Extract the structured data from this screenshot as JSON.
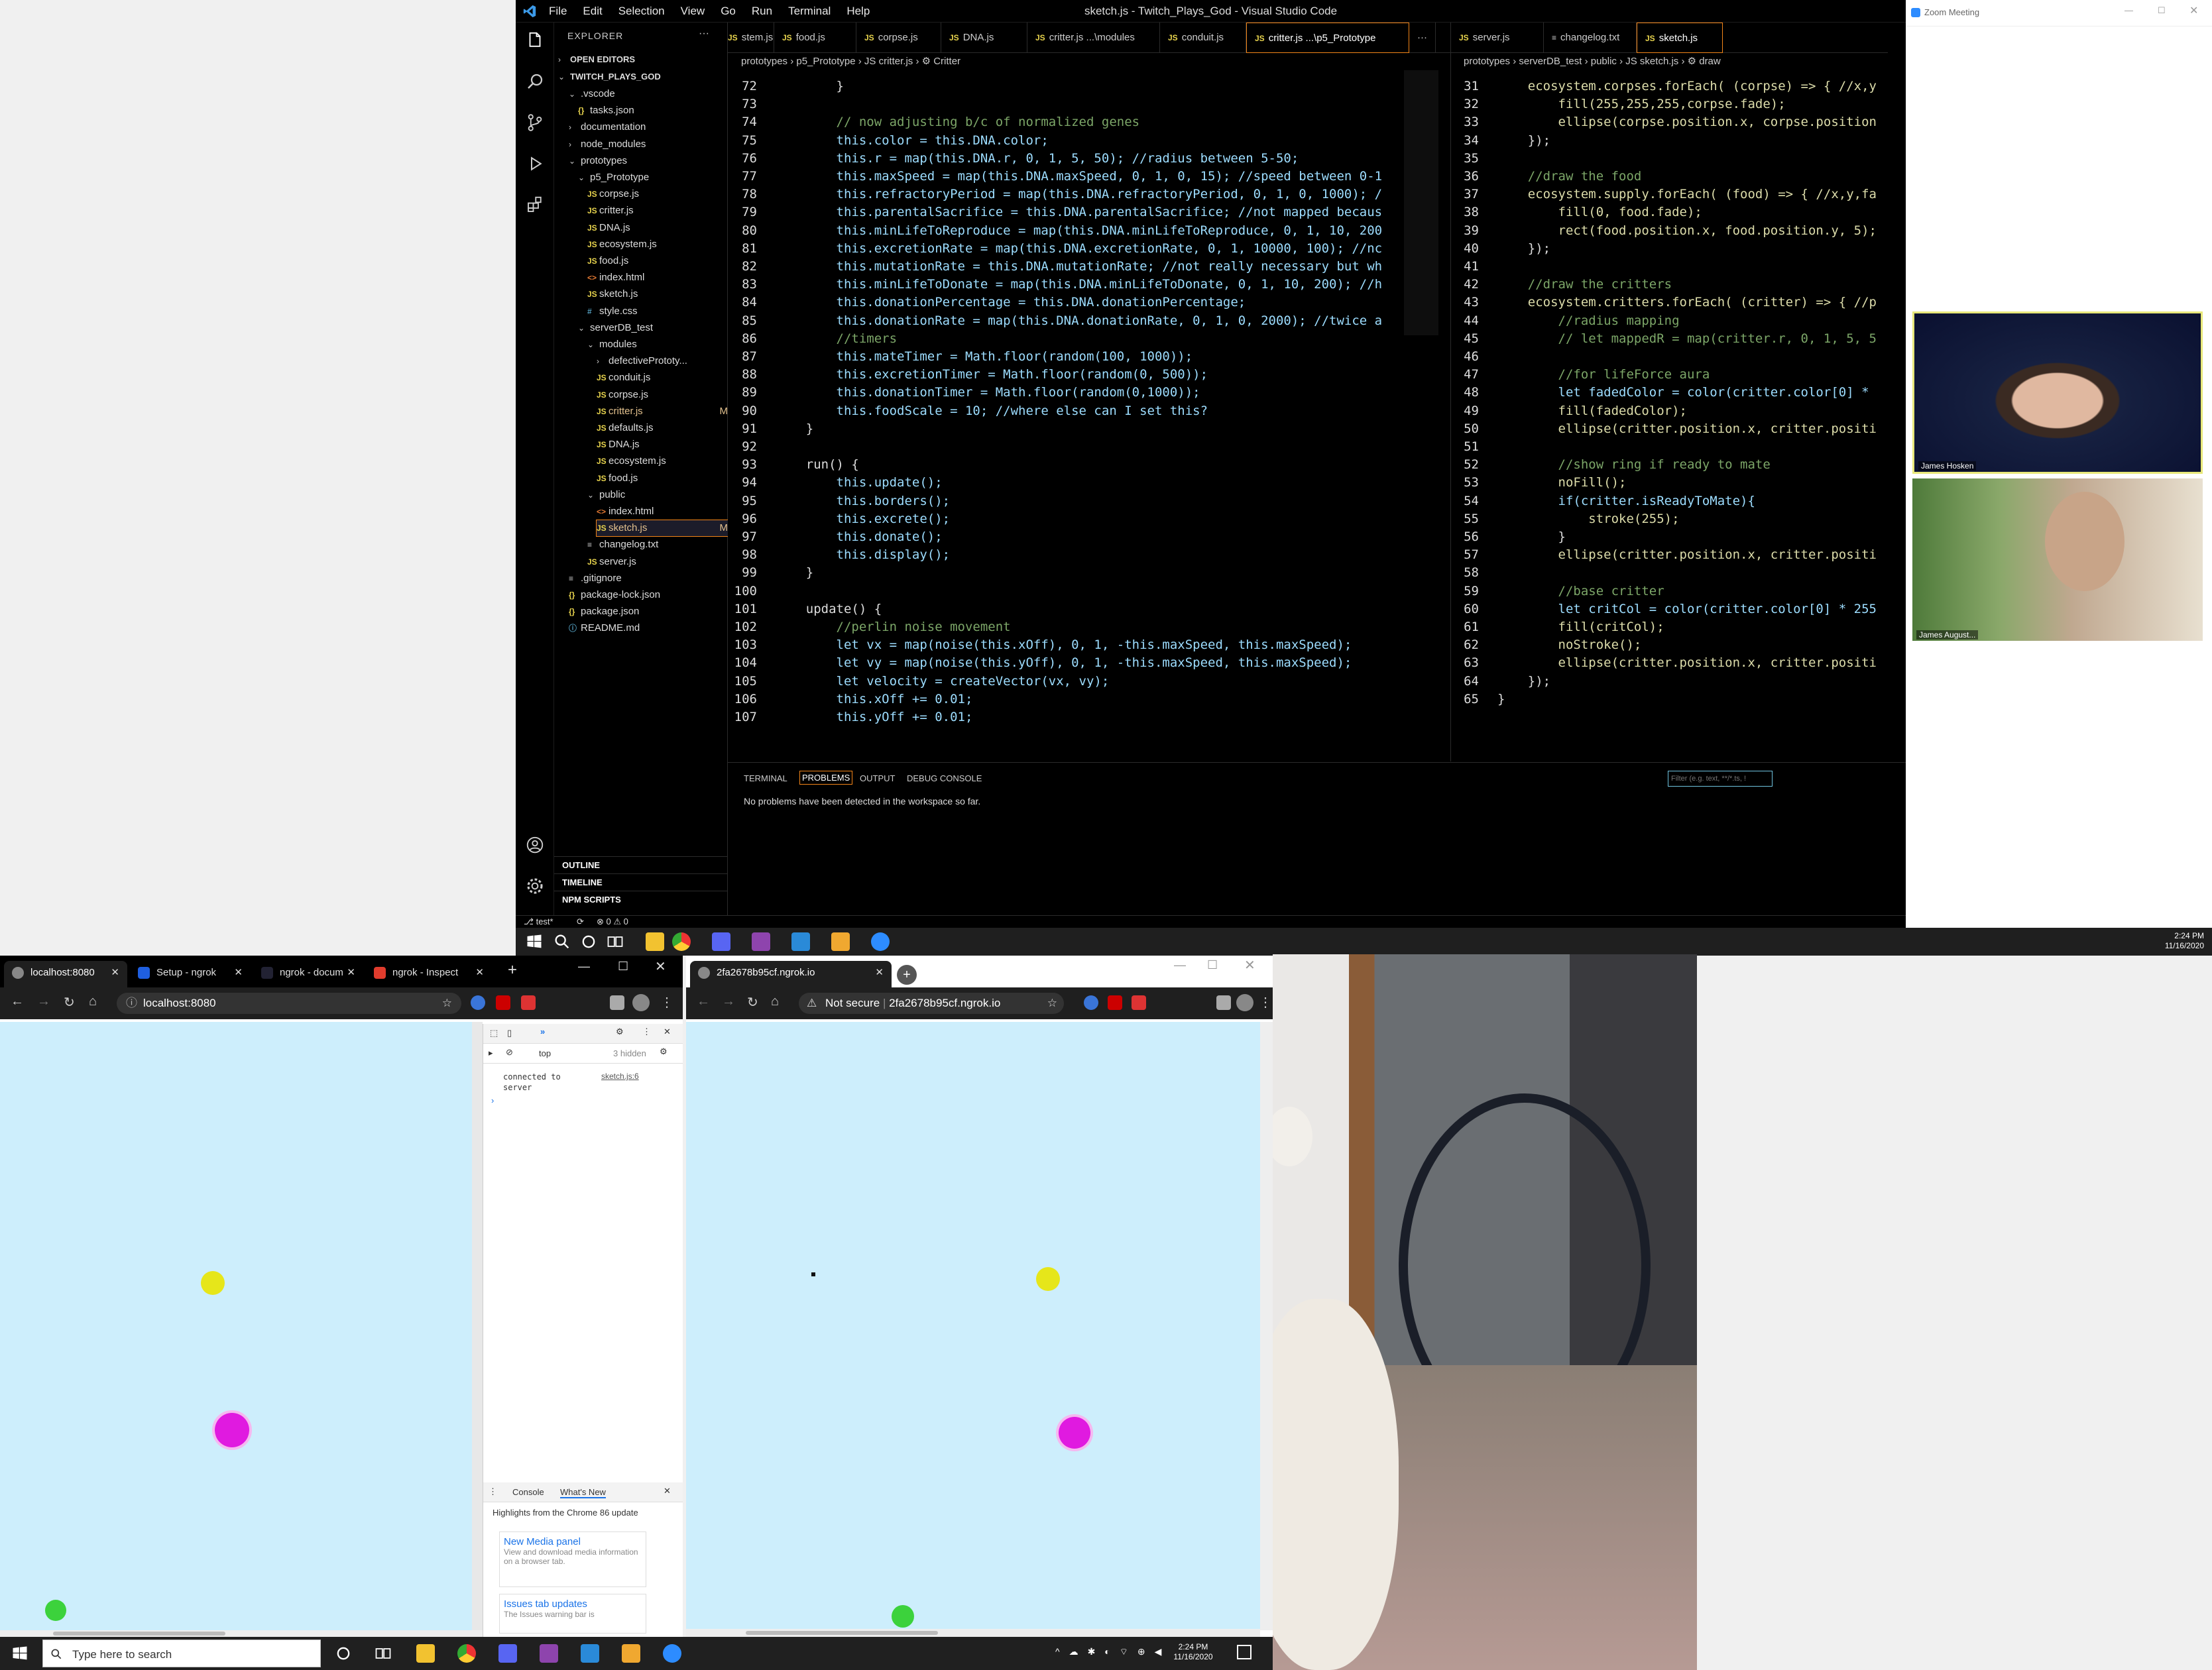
{
  "vscode": {
    "window_title": "sketch.js - Twitch_Plays_God - Visual Studio Code",
    "menu": [
      "File",
      "Edit",
      "Selection",
      "View",
      "Go",
      "Run",
      "Terminal",
      "Help"
    ],
    "explorer": {
      "header": "EXPLORER",
      "open_editors": "OPEN EDITORS",
      "root": "TWITCH_PLAYS_GOD",
      "tree": [
        {
          "label": ".vscode",
          "type": "folder-open",
          "depth": 1
        },
        {
          "label": "tasks.json",
          "type": "json",
          "depth": 2
        },
        {
          "label": "documentation",
          "type": "folder",
          "depth": 1
        },
        {
          "label": "node_modules",
          "type": "folder",
          "depth": 1
        },
        {
          "label": "prototypes",
          "type": "folder-open",
          "depth": 1
        },
        {
          "label": "p5_Prototype",
          "type": "folder-open",
          "depth": 2
        },
        {
          "label": "corpse.js",
          "type": "js",
          "depth": 3
        },
        {
          "label": "critter.js",
          "type": "js",
          "depth": 3
        },
        {
          "label": "DNA.js",
          "type": "js",
          "depth": 3
        },
        {
          "label": "ecosystem.js",
          "type": "js",
          "depth": 3
        },
        {
          "label": "food.js",
          "type": "js",
          "depth": 3
        },
        {
          "label": "index.html",
          "type": "html",
          "depth": 3
        },
        {
          "label": "sketch.js",
          "type": "js",
          "depth": 3
        },
        {
          "label": "style.css",
          "type": "css",
          "depth": 3
        },
        {
          "label": "serverDB_test",
          "type": "folder-open",
          "depth": 2
        },
        {
          "label": "modules",
          "type": "folder-open",
          "depth": 3
        },
        {
          "label": "defectivePrototy...",
          "type": "folder",
          "depth": 4
        },
        {
          "label": "conduit.js",
          "type": "js",
          "depth": 4
        },
        {
          "label": "corpse.js",
          "type": "js",
          "depth": 4
        },
        {
          "label": "critter.js",
          "type": "js",
          "depth": 4,
          "badge": "M"
        },
        {
          "label": "defaults.js",
          "type": "js",
          "depth": 4
        },
        {
          "label": "DNA.js",
          "type": "js",
          "depth": 4
        },
        {
          "label": "ecosystem.js",
          "type": "js",
          "depth": 4
        },
        {
          "label": "food.js",
          "type": "js",
          "depth": 4
        },
        {
          "label": "public",
          "type": "folder-open",
          "depth": 3
        },
        {
          "label": "index.html",
          "type": "html",
          "depth": 4
        },
        {
          "label": "sketch.js",
          "type": "js",
          "depth": 4,
          "badge": "M",
          "selected": true
        },
        {
          "label": "changelog.txt",
          "type": "txt",
          "depth": 3
        },
        {
          "label": "server.js",
          "type": "js",
          "depth": 3
        },
        {
          "label": ".gitignore",
          "type": "txt",
          "depth": 1
        },
        {
          "label": "package-lock.json",
          "type": "json",
          "depth": 1
        },
        {
          "label": "package.json",
          "type": "json",
          "depth": 1
        },
        {
          "label": "README.md",
          "type": "info",
          "depth": 1
        }
      ],
      "sections": [
        "OUTLINE",
        "TIMELINE",
        "NPM SCRIPTS"
      ]
    },
    "tabs_left": [
      "stem.js",
      "food.js",
      "corpse.js",
      "DNA.js",
      "critter.js ...\\modules",
      "conduit.js",
      "critter.js ...\\p5_Prototype"
    ],
    "tabs_right": [
      "server.js",
      "changelog.txt",
      "sketch.js"
    ],
    "tab_more": "···",
    "breadcrumb_left": "prototypes › p5_Prototype › JS critter.js › ⚙ Critter",
    "breadcrumb_right": "prototypes › serverDB_test › public › JS sketch.js › ⚙ draw",
    "left_code": [
      {
        "ln": "72",
        "code": "        }"
      },
      {
        "ln": "73",
        "code": ""
      },
      {
        "ln": "74",
        "code": "        // now adjusting b/c of normalized genes"
      },
      {
        "ln": "75",
        "code": "        this.color = this.DNA.color;"
      },
      {
        "ln": "76",
        "code": "        this.r = map(this.DNA.r, 0, 1, 5, 50); //radius between 5-50;"
      },
      {
        "ln": "77",
        "code": "        this.maxSpeed = map(this.DNA.maxSpeed, 0, 1, 0, 15); //speed between 0-1"
      },
      {
        "ln": "78",
        "code": "        this.refractoryPeriod = map(this.DNA.refractoryPeriod, 0, 1, 0, 1000); /"
      },
      {
        "ln": "79",
        "code": "        this.parentalSacrifice = this.DNA.parentalSacrifice; //not mapped becaus"
      },
      {
        "ln": "80",
        "code": "        this.minLifeToReproduce = map(this.DNA.minLifeToReproduce, 0, 1, 10, 200"
      },
      {
        "ln": "81",
        "code": "        this.excretionRate = map(this.DNA.excretionRate, 0, 1, 10000, 100); //nc"
      },
      {
        "ln": "82",
        "code": "        this.mutationRate = this.DNA.mutationRate; //not really necessary but wh"
      },
      {
        "ln": "83",
        "code": "        this.minLifeToDonate = map(this.DNA.minLifeToDonate, 0, 1, 10, 200); //h"
      },
      {
        "ln": "84",
        "code": "        this.donationPercentage = this.DNA.donationPercentage;"
      },
      {
        "ln": "85",
        "code": "        this.donationRate = map(this.DNA.donationRate, 0, 1, 0, 2000); //twice a"
      },
      {
        "ln": "86",
        "code": "        //timers"
      },
      {
        "ln": "87",
        "code": "        this.mateTimer = Math.floor(random(100, 1000));"
      },
      {
        "ln": "88",
        "code": "        this.excretionTimer = Math.floor(random(0, 500));"
      },
      {
        "ln": "89",
        "code": "        this.donationTimer = Math.floor(random(0,1000));"
      },
      {
        "ln": "90",
        "code": "        this.foodScale = 10; //where else can I set this?"
      },
      {
        "ln": "91",
        "code": "    }"
      },
      {
        "ln": "92",
        "code": ""
      },
      {
        "ln": "93",
        "code": "    run() {"
      },
      {
        "ln": "94",
        "code": "        this.update();"
      },
      {
        "ln": "95",
        "code": "        this.borders();"
      },
      {
        "ln": "96",
        "code": "        this.excrete();"
      },
      {
        "ln": "97",
        "code": "        this.donate();"
      },
      {
        "ln": "98",
        "code": "        this.display();"
      },
      {
        "ln": "99",
        "code": "    }"
      },
      {
        "ln": "100",
        "code": ""
      },
      {
        "ln": "101",
        "code": "    update() {"
      },
      {
        "ln": "102",
        "code": "        //perlin noise movement"
      },
      {
        "ln": "103",
        "code": "        let vx = map(noise(this.xOff), 0, 1, -this.maxSpeed, this.maxSpeed);"
      },
      {
        "ln": "104",
        "code": "        let vy = map(noise(this.yOff), 0, 1, -this.maxSpeed, this.maxSpeed);"
      },
      {
        "ln": "105",
        "code": "        let velocity = createVector(vx, vy);"
      },
      {
        "ln": "106",
        "code": "        this.xOff += 0.01;"
      },
      {
        "ln": "107",
        "code": "        this.yOff += 0.01;"
      }
    ],
    "right_code": [
      {
        "ln": "31",
        "code": "    ecosystem.corpses.forEach( (corpse) => { //x,y"
      },
      {
        "ln": "32",
        "code": "        fill(255,255,255,corpse.fade);"
      },
      {
        "ln": "33",
        "code": "        ellipse(corpse.position.x, corpse.position"
      },
      {
        "ln": "34",
        "code": "    });"
      },
      {
        "ln": "35",
        "code": ""
      },
      {
        "ln": "36",
        "code": "    //draw the food"
      },
      {
        "ln": "37",
        "code": "    ecosystem.supply.forEach( (food) => { //x,y,fa"
      },
      {
        "ln": "38",
        "code": "        fill(0, food.fade);"
      },
      {
        "ln": "39",
        "code": "        rect(food.position.x, food.position.y, 5);"
      },
      {
        "ln": "40",
        "code": "    });"
      },
      {
        "ln": "41",
        "code": ""
      },
      {
        "ln": "42",
        "code": "    //draw the critters"
      },
      {
        "ln": "43",
        "code": "    ecosystem.critters.forEach( (critter) => { //p"
      },
      {
        "ln": "44",
        "code": "        //radius mapping"
      },
      {
        "ln": "45",
        "code": "        // let mappedR = map(critter.r, 0, 1, 5, 5"
      },
      {
        "ln": "46",
        "code": ""
      },
      {
        "ln": "47",
        "code": "        //for lifeForce aura"
      },
      {
        "ln": "48",
        "code": "        let fadedColor = color(critter.color[0] *"
      },
      {
        "ln": "49",
        "code": "        fill(fadedColor);"
      },
      {
        "ln": "50",
        "code": "        ellipse(critter.position.x, critter.positi"
      },
      {
        "ln": "51",
        "code": ""
      },
      {
        "ln": "52",
        "code": "        //show ring if ready to mate"
      },
      {
        "ln": "53",
        "code": "        noFill();"
      },
      {
        "ln": "54",
        "code": "        if(critter.isReadyToMate){"
      },
      {
        "ln": "55",
        "code": "            stroke(255);"
      },
      {
        "ln": "56",
        "code": "        }"
      },
      {
        "ln": "57",
        "code": "        ellipse(critter.position.x, critter.positi"
      },
      {
        "ln": "58",
        "code": ""
      },
      {
        "ln": "59",
        "code": "        //base critter"
      },
      {
        "ln": "60",
        "code": "        let critCol = color(critter.color[0] * 255"
      },
      {
        "ln": "61",
        "code": "        fill(critCol);"
      },
      {
        "ln": "62",
        "code": "        noStroke();"
      },
      {
        "ln": "63",
        "code": "        ellipse(critter.position.x, critter.positi"
      },
      {
        "ln": "64",
        "code": "    });"
      },
      {
        "ln": "65",
        "code": "}"
      }
    ],
    "panel": {
      "tabs": [
        "TERMINAL",
        "PROBLEMS",
        "OUTPUT",
        "DEBUG CONSOLE"
      ],
      "active_tab": "PROBLEMS",
      "message": "No problems have been detected in the workspace so far.",
      "filter_placeholder": "Filter (e.g. text, **/*.ts, !"
    },
    "status": {
      "branch": "test*",
      "problems": "⊗ 0 ⚠ 0"
    }
  },
  "zoom": {
    "title": "Zoom Meeting",
    "participant1": "James Hosken",
    "participant2": "James August..."
  },
  "taskbar_top": {
    "time": "2:24 PM",
    "date": "11/16/2020"
  },
  "taskbar_bottom": {
    "search_placeholder": "Type here to search",
    "time": "2:24 PM",
    "date": "11/16/2020"
  },
  "browser1": {
    "tabs": [
      "localhost:8080",
      "Setup - ngrok",
      "ngrok - docum",
      "ngrok - Inspect"
    ],
    "url": "localhost:8080",
    "devtools": {
      "context": "top",
      "hidden": "3 hidden",
      "log_text": "connected to server",
      "log_source": "sketch.js:6",
      "drawer_tabs": [
        "Console",
        "What's New"
      ],
      "whats_new_title": "Highlights from the Chrome 86 update",
      "cards": [
        {
          "title": "New Media panel",
          "desc": "View and download media information on a browser tab."
        },
        {
          "title": "Issues tab updates",
          "desc": "The Issues warning bar is"
        }
      ]
    }
  },
  "browser2": {
    "tab": "2fa2678b95cf.ngrok.io",
    "security": "Not secure",
    "url": "2fa2678b95cf.ngrok.io"
  },
  "colors": {
    "canvas": "#cdeefc",
    "yellow_critter": "#e6e61a",
    "magenta_critter": "#e01ae0",
    "green_critter": "#3cd23c"
  }
}
